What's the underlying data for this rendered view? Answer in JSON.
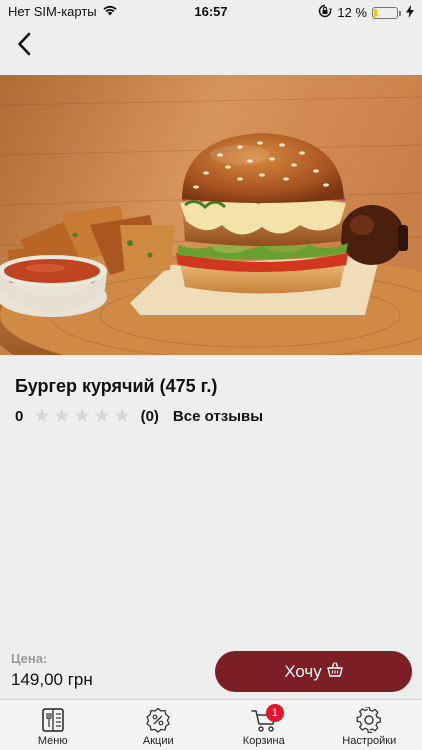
{
  "status_bar": {
    "carrier": "Нет SIM-карты",
    "time": "16:57",
    "battery_percent": "12 %",
    "battery_level": 0.12,
    "icons": [
      "wifi-icon",
      "orientation-lock-icon",
      "battery-icon",
      "charging-icon"
    ]
  },
  "nav": {
    "back_icon": "chevron-left-icon"
  },
  "product": {
    "title": "Бургер курячий (475 г.)",
    "image": "burger-photo",
    "rating_value": "0",
    "stars_filled": 0,
    "stars_total": 5,
    "reviews_count": "(0)",
    "all_reviews_label": "Все отзывы"
  },
  "purchase": {
    "price_label": "Цена:",
    "price": "149,00 грн",
    "button_label": "Хочу",
    "button_icon": "basket-icon",
    "button_color": "#7b1e26"
  },
  "tabs": [
    {
      "label": "Меню",
      "icon": "menu-book-icon"
    },
    {
      "label": "Акции",
      "icon": "percent-badge-icon"
    },
    {
      "label": "Корзина",
      "icon": "cart-icon",
      "badge": "1"
    },
    {
      "label": "Настройки",
      "icon": "gear-icon"
    }
  ],
  "colors": {
    "background": "#efeeee",
    "accent": "#7b1e26",
    "badge": "#e5142a",
    "star_empty": "#d6d6d6"
  }
}
